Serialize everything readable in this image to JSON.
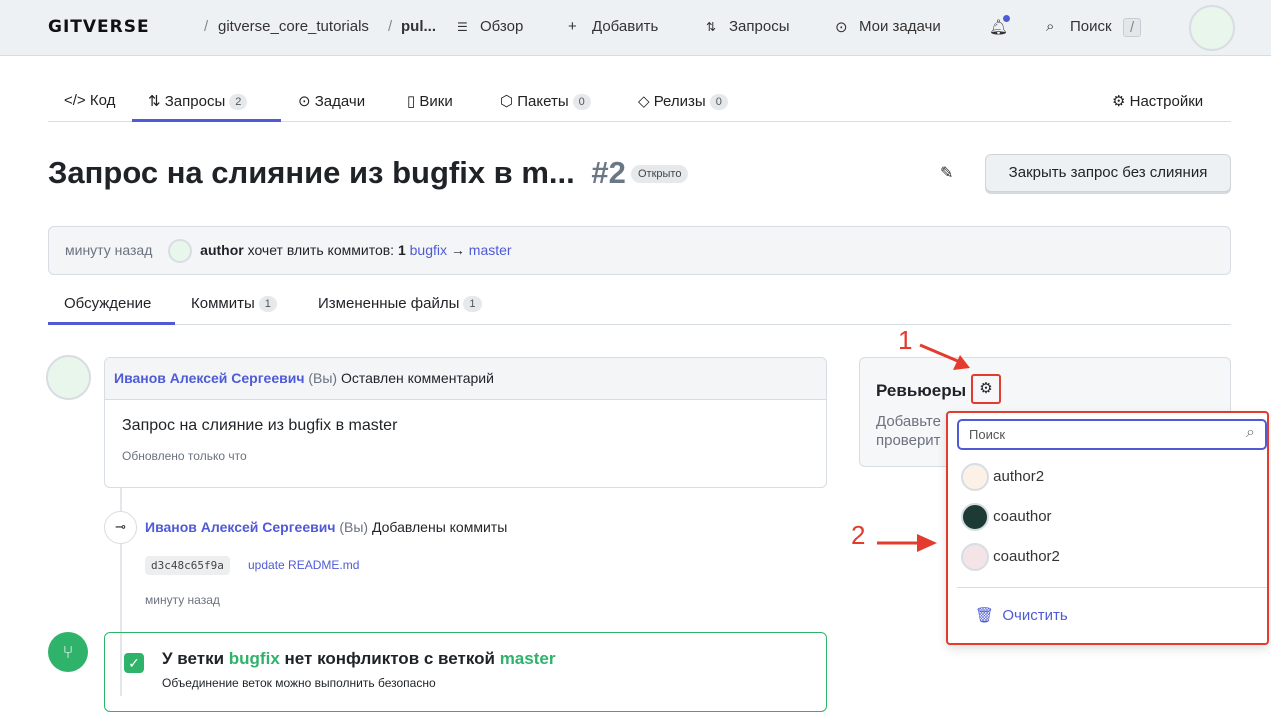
{
  "header": {
    "logo": "GITVERSE",
    "breadcrumb": [
      "gitverse_core_tutorials",
      "pul..."
    ],
    "nav": [
      "Обзор",
      "Добавить",
      "Запросы",
      "Мои задачи"
    ],
    "search": "Поиск",
    "search_key": "/",
    "notification_dot": "#4f5bd5"
  },
  "repo_tabs": [
    {
      "label": "Код"
    },
    {
      "label": "Запросы",
      "count": "2",
      "active": true
    },
    {
      "label": "Задачи"
    },
    {
      "label": "Вики"
    },
    {
      "label": "Пакеты",
      "count": "0"
    },
    {
      "label": "Релизы",
      "count": "0"
    }
  ],
  "settings": "Настройки",
  "pr": {
    "title": "Запрос на слияние из bugfix в m...",
    "number": "#2",
    "status": "Открыто",
    "close_button": "Закрыть запрос без слияния",
    "info": {
      "time": "минуту назад",
      "author": "author",
      "text": "хочет влить коммитов:",
      "commits": "1",
      "from": "bugfix",
      "arrow": "→",
      "to": "master"
    }
  },
  "sub_tabs": [
    {
      "label": "Обсуждение",
      "active": true
    },
    {
      "label": "Коммиты",
      "count": "1"
    },
    {
      "label": "Измененные файлы",
      "count": "1"
    }
  ],
  "comment": {
    "author": "Иванов Алексей Сергеевич",
    "you": "(Вы)",
    "action": "Оставлен комментарий",
    "body": "Запрос на слияние из bugfix в master",
    "updated": "Обновлено только что"
  },
  "commit_event": {
    "author": "Иванов Алексей Сергеевич",
    "you": "(Вы)",
    "action": "Добавлены коммиты",
    "hash": "d3c48c65f9a",
    "message": "update README.md",
    "time": "минуту назад"
  },
  "merge": {
    "pre": "У ветки",
    "branch": "bugfix",
    "mid": "нет конфликтов с веткой",
    "target": "master",
    "sub": "Объединение веток можно выполнить безопасно",
    "color": "#2fb36a"
  },
  "reviewers": {
    "title": "Ревьюеры",
    "desc_line1": "Добавьте",
    "desc_line2": "проверит"
  },
  "dropdown": {
    "placeholder": "Поиск",
    "users": [
      "author2",
      "coauthor",
      "coauthor2"
    ],
    "clear": "Очистить"
  },
  "annotations": [
    "1",
    "2"
  ]
}
